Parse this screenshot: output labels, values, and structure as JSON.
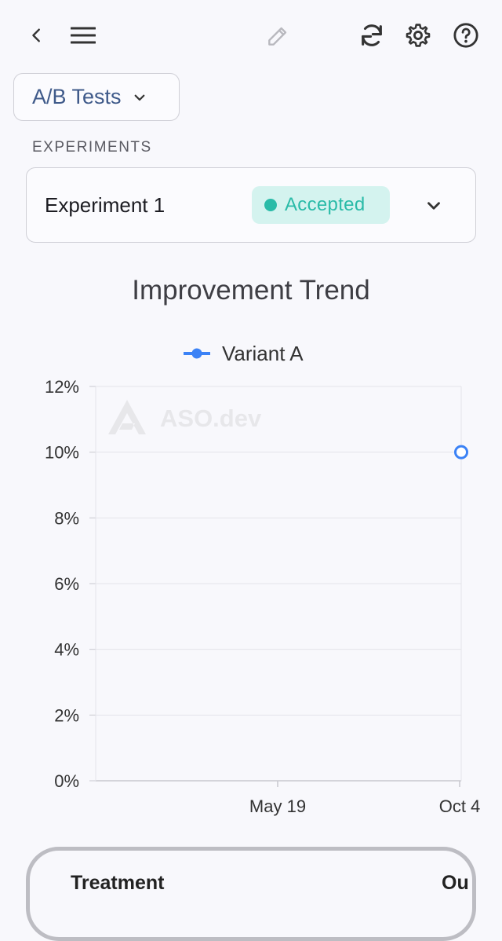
{
  "toolbar": {
    "back_icon": "chevron-left-icon",
    "menu_icon": "hamburger-icon",
    "edit_icon": "pencil-icon",
    "refresh_icon": "refresh-icon",
    "settings_icon": "gear-icon",
    "help_icon": "question-circle-icon"
  },
  "page_selector": {
    "label": "A/B Tests"
  },
  "experiments_section": {
    "label": "EXPERIMENTS",
    "selected": {
      "name": "Experiment 1",
      "status": "Accepted",
      "status_color": "#2abba8"
    }
  },
  "chart_title": "Improvement Trend",
  "watermark": "ASO.dev",
  "chart_data": {
    "type": "line",
    "title": "Improvement Trend",
    "xlabel": "",
    "ylabel": "",
    "x_ticks": [
      "May 19",
      "Oct 4"
    ],
    "y_ticks": [
      "0%",
      "2%",
      "4%",
      "6%",
      "8%",
      "10%",
      "12%"
    ],
    "ylim": [
      0,
      12
    ],
    "grid": true,
    "legend_position": "top-center",
    "series": [
      {
        "name": "Variant A",
        "color": "#3b82f6",
        "points": [
          {
            "x": "Oct 4",
            "y": 10
          }
        ]
      }
    ]
  },
  "table": {
    "headers": [
      "Treatment",
      "Ou"
    ]
  }
}
